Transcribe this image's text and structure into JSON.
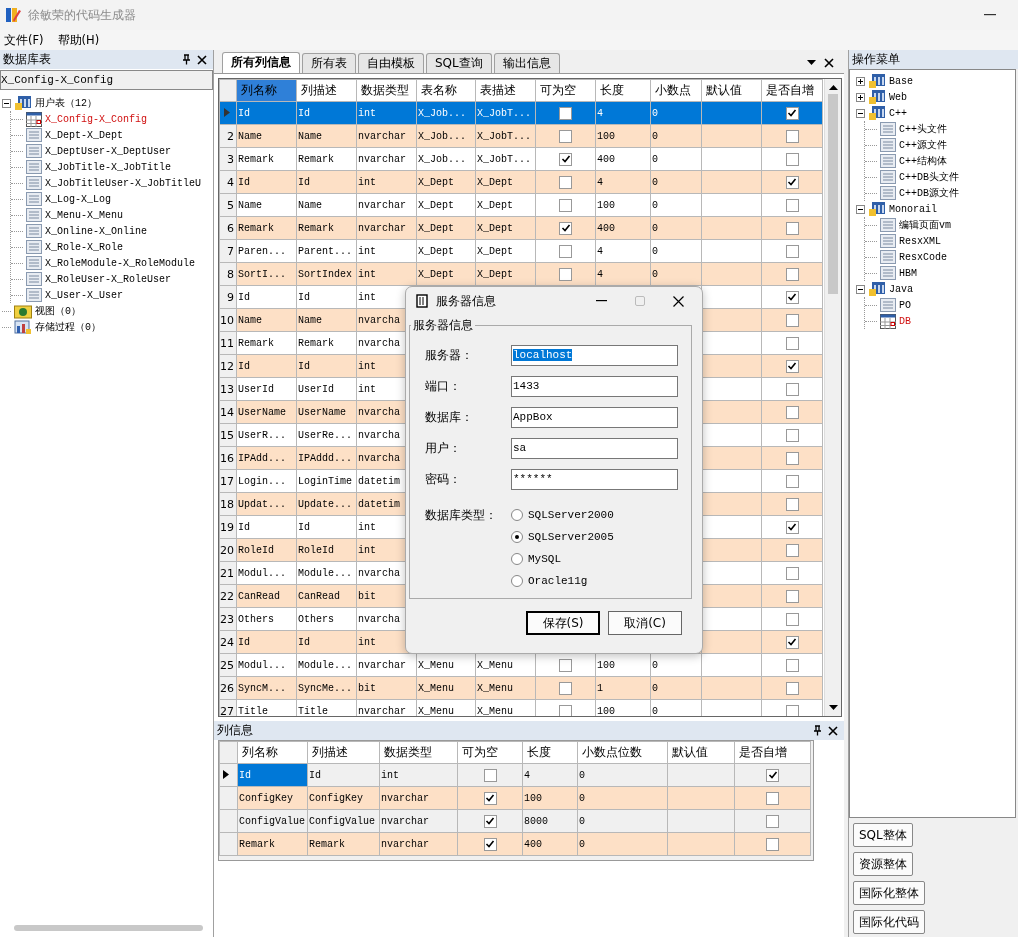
{
  "window": {
    "title": "徐敏荣的代码生成器"
  },
  "menu": [
    "文件(F)",
    "帮助(H)"
  ],
  "db_panel": {
    "title": "数据库表",
    "selection": "X_Config-X_Config",
    "tree": [
      {
        "label": "用户表（12）",
        "kind": "group",
        "expanded": true,
        "children": [
          {
            "label": "X_Config-X_Config",
            "kind": "table",
            "selected": true
          },
          {
            "label": "X_Dept-X_Dept",
            "kind": "table",
            "selected": false
          },
          {
            "label": "X_DeptUser-X_DeptUser",
            "kind": "table",
            "selected": false
          },
          {
            "label": "X_JobTitle-X_JobTitle",
            "kind": "table",
            "selected": false
          },
          {
            "label": "X_JobTitleUser-X_JobTitleU",
            "kind": "table",
            "selected": false
          },
          {
            "label": "X_Log-X_Log",
            "kind": "table",
            "selected": false
          },
          {
            "label": "X_Menu-X_Menu",
            "kind": "table",
            "selected": false
          },
          {
            "label": "X_Online-X_Online",
            "kind": "table",
            "selected": false
          },
          {
            "label": "X_Role-X_Role",
            "kind": "table",
            "selected": false
          },
          {
            "label": "X_RoleModule-X_RoleModule",
            "kind": "table",
            "selected": false
          },
          {
            "label": "X_RoleUser-X_RoleUser",
            "kind": "table",
            "selected": false
          },
          {
            "label": "X_User-X_User",
            "kind": "table",
            "selected": false
          }
        ]
      },
      {
        "label": "视图（0）",
        "kind": "view"
      },
      {
        "label": "存储过程（0）",
        "kind": "proc"
      }
    ]
  },
  "tabs": [
    {
      "label": "所有列信息",
      "selected": true
    },
    {
      "label": "所有表",
      "selected": false
    },
    {
      "label": "自由模板",
      "selected": false
    },
    {
      "label": "SQL查询",
      "selected": false
    },
    {
      "label": "输出信息",
      "selected": false
    }
  ],
  "grid": {
    "columns": [
      {
        "label": "列名称",
        "selected": true
      },
      {
        "label": "列描述",
        "selected": false
      },
      {
        "label": "数据类型",
        "selected": false
      },
      {
        "label": "表名称",
        "selected": false
      },
      {
        "label": "表描述",
        "selected": false
      },
      {
        "label": "可为空",
        "selected": false
      },
      {
        "label": "长度",
        "selected": false
      },
      {
        "label": "小数点",
        "selected": false
      },
      {
        "label": "默认值",
        "selected": false
      },
      {
        "label": "是否自增",
        "selected": false
      }
    ],
    "rows": [
      {
        "current": true,
        "cells": [
          "Id",
          "Id",
          "int",
          "X_Job...",
          "X_JobT..."
        ],
        "nullable": false,
        "length": "4",
        "scale": "0",
        "auto_increment": true,
        "selected": true
      },
      {
        "number": "2",
        "cells": [
          "Name",
          "Name",
          "nvarchar",
          "X_Job...",
          "X_JobT..."
        ],
        "nullable": false,
        "length": "100",
        "scale": "0",
        "auto_increment": false,
        "selected": false
      },
      {
        "number": "3",
        "cells": [
          "Remark",
          "Remark",
          "nvarchar",
          "X_Job...",
          "X_JobT..."
        ],
        "nullable": true,
        "length": "400",
        "scale": "0",
        "auto_increment": false,
        "selected": false
      },
      {
        "number": "4",
        "cells": [
          "Id",
          "Id",
          "int",
          "X_Dept",
          "X_Dept"
        ],
        "nullable": false,
        "length": "4",
        "scale": "0",
        "auto_increment": true,
        "selected": false
      },
      {
        "number": "5",
        "cells": [
          "Name",
          "Name",
          "nvarchar",
          "X_Dept",
          "X_Dept"
        ],
        "nullable": false,
        "length": "100",
        "scale": "0",
        "auto_increment": false,
        "selected": false
      },
      {
        "number": "6",
        "cells": [
          "Remark",
          "Remark",
          "nvarchar",
          "X_Dept",
          "X_Dept"
        ],
        "nullable": true,
        "length": "400",
        "scale": "0",
        "auto_increment": false,
        "selected": false
      },
      {
        "number": "7",
        "cells": [
          "Paren...",
          "Parent...",
          "int",
          "X_Dept",
          "X_Dept"
        ],
        "nullable": false,
        "length": "4",
        "scale": "0",
        "auto_increment": false,
        "selected": false
      },
      {
        "number": "8",
        "cells": [
          "SortI...",
          "SortIndex",
          "int",
          "X_Dept",
          "X_Dept"
        ],
        "nullable": false,
        "length": "4",
        "scale": "0",
        "auto_increment": false,
        "selected": false
      },
      {
        "number": "9",
        "cells": [
          "Id",
          "Id",
          "int"
        ],
        "auto_increment": true,
        "selected": false
      },
      {
        "number": "10",
        "cells": [
          "Name",
          "Name",
          "nvarcha"
        ],
        "auto_increment": false,
        "selected": false
      },
      {
        "number": "11",
        "cells": [
          "Remark",
          "Remark",
          "nvarcha"
        ],
        "auto_increment": false,
        "selected": false
      },
      {
        "number": "12",
        "cells": [
          "Id",
          "Id",
          "int"
        ],
        "auto_increment": true,
        "selected": false
      },
      {
        "number": "13",
        "cells": [
          "UserId",
          "UserId",
          "int"
        ],
        "auto_increment": false,
        "selected": false
      },
      {
        "number": "14",
        "cells": [
          "UserName",
          "UserName",
          "nvarcha"
        ],
        "auto_increment": false,
        "selected": false
      },
      {
        "number": "15",
        "cells": [
          "UserR...",
          "UserRe...",
          "nvarcha"
        ],
        "auto_increment": false,
        "selected": false
      },
      {
        "number": "16",
        "cells": [
          "IPAdd...",
          "IPAddd...",
          "nvarcha"
        ],
        "auto_increment": false,
        "selected": false
      },
      {
        "number": "17",
        "cells": [
          "Login...",
          "LoginTime",
          "datetim"
        ],
        "auto_increment": false,
        "selected": false
      },
      {
        "number": "18",
        "cells": [
          "Updat...",
          "Update...",
          "datetim"
        ],
        "auto_increment": false,
        "selected": false
      },
      {
        "number": "19",
        "cells": [
          "Id",
          "Id",
          "int"
        ],
        "auto_increment": true,
        "selected": false
      },
      {
        "number": "20",
        "cells": [
          "RoleId",
          "RoleId",
          "int"
        ],
        "auto_increment": false,
        "selected": false
      },
      {
        "number": "21",
        "cells": [
          "Modul...",
          "Module...",
          "nvarcha"
        ],
        "auto_increment": false,
        "selected": false
      },
      {
        "number": "22",
        "cells": [
          "CanRead",
          "CanRead",
          "bit"
        ],
        "auto_increment": false,
        "selected": false
      },
      {
        "number": "23",
        "cells": [
          "Others",
          "Others",
          "nvarcha"
        ],
        "auto_increment": false,
        "selected": false
      },
      {
        "number": "24",
        "cells": [
          "Id",
          "Id",
          "int"
        ],
        "auto_increment": true,
        "selected": false
      },
      {
        "number": "25",
        "cells": [
          "Modul...",
          "Module...",
          "nvarchar",
          "X_Menu",
          "X_Menu"
        ],
        "nullable": false,
        "length": "100",
        "scale": "0",
        "auto_increment": false,
        "selected": false
      },
      {
        "number": "26",
        "cells": [
          "SyncM...",
          "SyncMe...",
          "bit",
          "X_Menu",
          "X_Menu"
        ],
        "nullable": false,
        "length": "1",
        "scale": "0",
        "auto_increment": false,
        "selected": false
      },
      {
        "number": "27",
        "cells": [
          "Title",
          "Title",
          "nvarchar",
          "X_Menu",
          "X_Menu"
        ],
        "nullable": false,
        "length": "100",
        "scale": "0",
        "auto_increment": false,
        "selected": false
      }
    ]
  },
  "column_panel": {
    "title": "列信息",
    "columns": [
      "列名称",
      "列描述",
      "数据类型",
      "可为空",
      "长度",
      "小数点位数",
      "默认值",
      "是否自增"
    ],
    "rows": [
      {
        "current": true,
        "cells": [
          "Id",
          "Id",
          "int"
        ],
        "nullable": false,
        "length": "4",
        "scale": "0",
        "auto_increment": true,
        "selected": true
      },
      {
        "cells": [
          "ConfigKey",
          "ConfigKey",
          "nvarchar"
        ],
        "nullable": true,
        "length": "100",
        "scale": "0",
        "auto_increment": false,
        "selected": false
      },
      {
        "cells": [
          "ConfigValue",
          "ConfigValue",
          "nvarchar"
        ],
        "nullable": true,
        "length": "8000",
        "scale": "0",
        "auto_increment": false,
        "selected": false
      },
      {
        "cells": [
          "Remark",
          "Remark",
          "nvarchar"
        ],
        "nullable": true,
        "length": "400",
        "scale": "0",
        "auto_increment": false,
        "selected": false
      }
    ]
  },
  "ops_panel": {
    "title": "操作菜单",
    "tree": [
      {
        "label": "Base",
        "kind": "group",
        "expanded": false
      },
      {
        "label": "Web",
        "kind": "group",
        "expanded": false
      },
      {
        "label": "C++",
        "kind": "group",
        "expanded": true,
        "children": [
          {
            "label": "C++头文件",
            "kind": "table",
            "selected": false
          },
          {
            "label": "C++源文件",
            "kind": "table",
            "selected": false
          },
          {
            "label": "C++结构体",
            "kind": "table",
            "selected": false
          },
          {
            "label": "C++DB头文件",
            "kind": "table",
            "selected": false
          },
          {
            "label": "C++DB源文件",
            "kind": "table",
            "selected": false
          }
        ]
      },
      {
        "label": "Monorail",
        "kind": "group",
        "expanded": true,
        "children": [
          {
            "label": "编辑页面vm",
            "kind": "table",
            "selected": false
          },
          {
            "label": "ResxXML",
            "kind": "table",
            "selected": false
          },
          {
            "label": "ResxCode",
            "kind": "table",
            "selected": false
          },
          {
            "label": "HBM",
            "kind": "table",
            "selected": false
          }
        ]
      },
      {
        "label": "Java",
        "kind": "group",
        "expanded": true,
        "children": [
          {
            "label": "PO",
            "kind": "table",
            "selected": false
          },
          {
            "label": "DB",
            "kind": "table",
            "selected": true
          }
        ]
      }
    ],
    "buttons": [
      "SQL整体",
      "资源整体",
      "国际化整体",
      "国际化代码"
    ]
  },
  "dialog": {
    "title": "服务器信息",
    "group": "服务器信息",
    "fields": [
      {
        "label": "服务器：",
        "value": "localhost",
        "highlighted": true
      },
      {
        "label": "端口：",
        "value": "1433",
        "highlighted": false
      },
      {
        "label": "数据库：",
        "value": "AppBox",
        "highlighted": false
      },
      {
        "label": "用户：",
        "value": "sa",
        "highlighted": false
      },
      {
        "label": "密码：",
        "value": "******",
        "highlighted": false
      }
    ],
    "db_type_label": "数据库类型：",
    "db_types": [
      {
        "label": "SQLServer2000",
        "selected": false
      },
      {
        "label": "SQLServer2005",
        "selected": true
      },
      {
        "label": "MySQL",
        "selected": false
      },
      {
        "label": "Oracle11g",
        "selected": false
      }
    ],
    "buttons": [
      {
        "label": "保存(S)",
        "default": true
      },
      {
        "label": "取消(C)",
        "default": false
      }
    ]
  }
}
